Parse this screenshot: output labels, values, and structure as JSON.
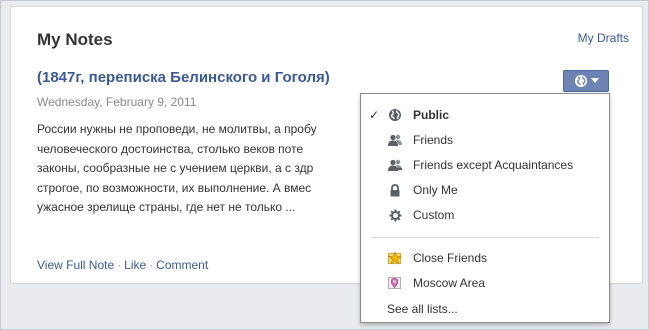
{
  "header": {
    "title": "My Notes",
    "drafts_link": "My Drafts"
  },
  "note": {
    "title": "(1847г, переписка Белинского и Гоголя)",
    "date": "Wednesday, February 9, 2011",
    "body_lines": [
      "России нужны не проповеди, не молитвы, а пробу",
      "человеческого достоинства, столько веков поте",
      "законы, сообразные не с учением церкви, а с здр",
      "строгое, по возможности, их выполнение. А вмес",
      "ужасное зрелище страны, где нет не только ..."
    ],
    "links": {
      "view": "View Full Note",
      "like": "Like",
      "comment": "Comment",
      "separator": "·"
    }
  },
  "privacy_button": {
    "icon": "globe-icon",
    "caret": "caret-down-icon"
  },
  "privacy_menu": {
    "items": [
      {
        "label": "Public",
        "icon": "globe-icon",
        "checked": true,
        "bold": true
      },
      {
        "label": "Friends",
        "icon": "friends-icon",
        "checked": false
      },
      {
        "label": "Friends except Acquaintances",
        "icon": "friends-except-icon",
        "checked": false
      },
      {
        "label": "Only Me",
        "icon": "lock-icon",
        "checked": false
      },
      {
        "label": "Custom",
        "icon": "gear-icon",
        "checked": false
      }
    ],
    "lists": [
      {
        "label": "Close Friends",
        "icon": "star-icon"
      },
      {
        "label": "Moscow Area",
        "icon": "location-pin-icon"
      }
    ],
    "see_all": "See all lists...",
    "check_mark": "✓"
  },
  "colors": {
    "link": "#3b5998",
    "button_bg": "#6d84b4",
    "page_bg": "#e9ebee"
  }
}
